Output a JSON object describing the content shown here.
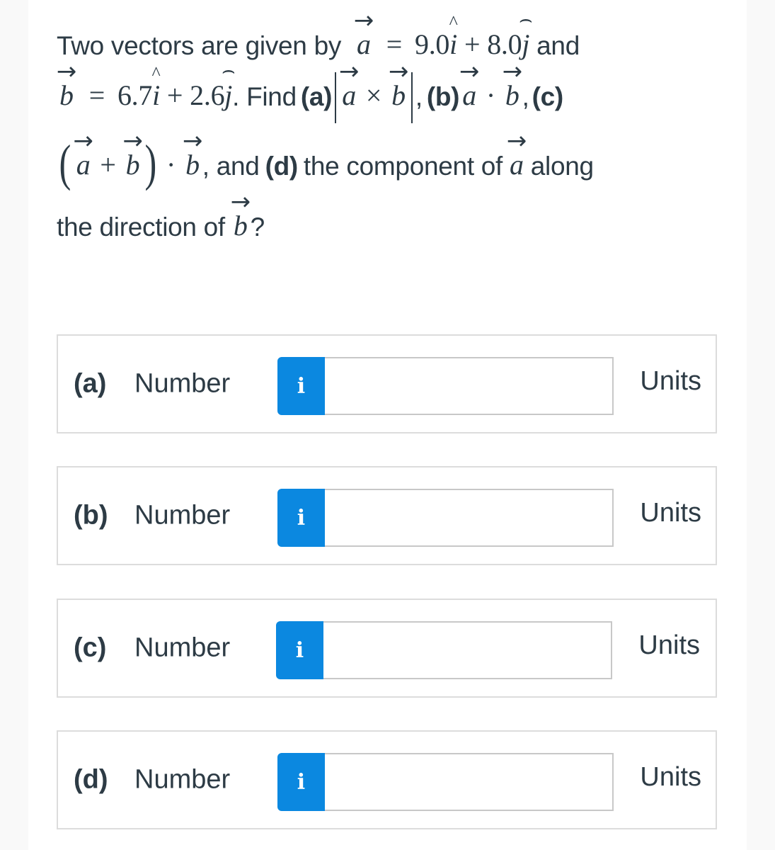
{
  "question": {
    "intro": "Two vectors are given by",
    "vec_a": "a",
    "vec_b": "b",
    "equals": "=",
    "a_x": "9.0",
    "a_y": "8.0",
    "b_x": "6.7",
    "b_y": "2.6",
    "unit_i": "i",
    "unit_j": "j",
    "plus": "+",
    "and": "and",
    "find": ". Find",
    "part_a_label": "(a)",
    "cross": "×",
    "comma": ",",
    "part_b_label": "(b)",
    "dot": "·",
    "part_c_label": "(c)",
    "paren_open": "(",
    "paren_close": ")",
    "and_d": ", and",
    "part_d_label": "(d)",
    "d_text": "the component of",
    "along": "along",
    "direction_text": "the direction of",
    "question_mark": "?"
  },
  "answers": [
    {
      "part": "(a)",
      "type": "Number",
      "info": "i",
      "value": "",
      "units": "Units"
    },
    {
      "part": "(b)",
      "type": "Number",
      "info": "i",
      "value": "",
      "units": "Units"
    },
    {
      "part": "(c)",
      "type": "Number",
      "info": "i",
      "value": "",
      "units": "Units"
    },
    {
      "part": "(d)",
      "type": "Number",
      "info": "i",
      "value": "",
      "units": "Units"
    }
  ],
  "colors": {
    "info_button": "#0b88e0",
    "text": "#2d3b45",
    "border": "#dcdcdc",
    "page_background": "#ffffff",
    "side_background": "#f9f9f9"
  }
}
